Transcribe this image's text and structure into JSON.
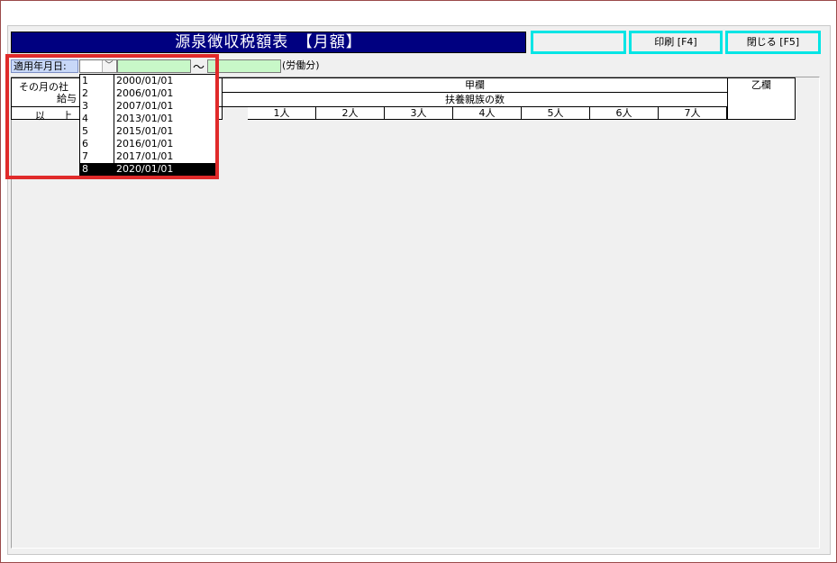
{
  "window": {
    "title": "源泉徴収税額表　【月額】"
  },
  "toolbar": {
    "print_label": "印刷 [F4]",
    "close_label": "閉じる [F5]"
  },
  "date_filter": {
    "label": "適用年月日:",
    "tilde": "～",
    "note": "(労働分)"
  },
  "dropdown": {
    "options": [
      {
        "index": "1",
        "date": "2000/01/01"
      },
      {
        "index": "2",
        "date": "2006/01/01"
      },
      {
        "index": "3",
        "date": "2007/01/01"
      },
      {
        "index": "4",
        "date": "2013/01/01"
      },
      {
        "index": "5",
        "date": "2015/01/01"
      },
      {
        "index": "6",
        "date": "2016/01/01"
      },
      {
        "index": "7",
        "date": "2017/01/01"
      },
      {
        "index": "8",
        "date": "2020/01/01"
      }
    ],
    "selected_index": 7
  },
  "table_header": {
    "left_line1": "その月の社",
    "left_line2": "給与",
    "left_col_ijo": "以",
    "left_col_ue": "上",
    "kou_label": "甲欄",
    "dependents_label": "扶養親族の数",
    "otsu_label": "乙欄",
    "dependents": [
      "1人",
      "2人",
      "3人",
      "4人",
      "5人",
      "6人",
      "7人"
    ]
  }
}
